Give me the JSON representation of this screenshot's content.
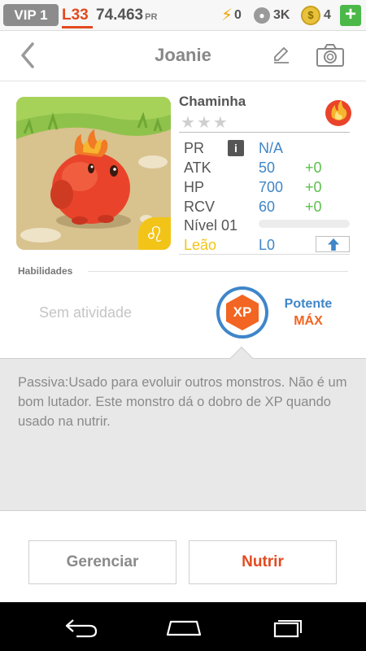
{
  "topbar": {
    "vip": "VIP 1",
    "level": "L33",
    "coins_value": "74.463",
    "coins_unit": "PR",
    "energy": "0",
    "paws": "3K",
    "gold": "4",
    "plus_label": "+"
  },
  "header": {
    "title": "Joanie",
    "icons": [
      "back-icon",
      "pencil-icon",
      "camera-icon"
    ]
  },
  "monster": {
    "species": "Chaminha",
    "stars_total": 3,
    "stars_filled": 0,
    "element": "fire",
    "zodiac_symbol": "♌",
    "stats": {
      "pr": {
        "label": "PR",
        "value": "N/A"
      },
      "atk": {
        "label": "ATK",
        "value": "50",
        "bonus": "+0"
      },
      "hp": {
        "label": "HP",
        "value": "700",
        "bonus": "+0"
      },
      "rcv": {
        "label": "RCV",
        "value": "60",
        "bonus": "+0"
      },
      "level": {
        "label": "Nível 01",
        "progress": 0
      },
      "sign": {
        "label": "Leão",
        "value": "L0"
      }
    },
    "info_label": "i"
  },
  "abilities": {
    "section_label": "Habilidades",
    "none_text": "Sem atividade",
    "badge": "XP",
    "power_label": "Potente",
    "power_level": "MÁX"
  },
  "description": {
    "text": "Passiva:Usado para evoluir outros monstros. Não é um bom lutador. Este monstro dá o dobro de XP quando usado na nutrir."
  },
  "actions": {
    "manage": "Gerenciar",
    "feed": "Nutrir"
  },
  "colors": {
    "accent_blue": "#3f86c9",
    "accent_orange": "#f26522",
    "bonus_green": "#5cbf4c",
    "zodiac_yellow": "#f2c418"
  }
}
